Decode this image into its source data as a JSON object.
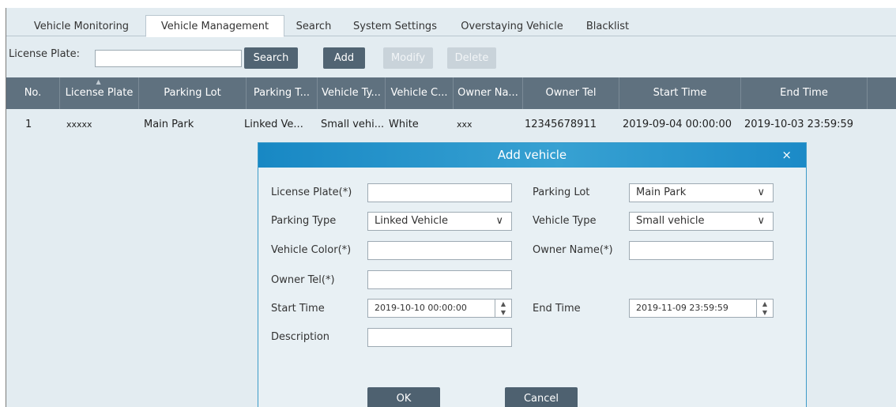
{
  "tabs": [
    {
      "label": "Vehicle Monitoring",
      "active": false
    },
    {
      "label": "Vehicle Management",
      "active": true
    },
    {
      "label": "Search",
      "active": false
    },
    {
      "label": "System Settings",
      "active": false
    },
    {
      "label": "Overstaying Vehicle",
      "active": false
    },
    {
      "label": "Blacklist",
      "active": false
    }
  ],
  "toolbar": {
    "license_plate_label": "License Plate:",
    "license_plate_value": "",
    "search_label": "Search",
    "add_label": "Add",
    "modify_label": "Modify",
    "delete_label": "Delete"
  },
  "table": {
    "columns": [
      "No.",
      "License Plate",
      "Parking Lot",
      "Parking T...",
      "Vehicle Ty...",
      "Vehicle C...",
      "Owner Na...",
      "Owner Tel",
      "Start Time",
      "End Time"
    ],
    "rows": [
      [
        "1",
        "xxxxx",
        "Main Park",
        "Linked Ve...",
        "Small vehi...",
        "White",
        "xxx",
        "12345678911",
        "2019-09-04 00:00:00",
        "2019-10-03 23:59:59"
      ]
    ]
  },
  "dialog": {
    "title": "Add vehicle",
    "close_glyph": "×",
    "license_plate_label": "License Plate(*)",
    "license_plate_value": "",
    "parking_lot_label": "Parking Lot",
    "parking_lot_value": "Main Park",
    "parking_type_label": "Parking Type",
    "parking_type_value": "Linked Vehicle",
    "vehicle_type_label": "Vehicle Type",
    "vehicle_type_value": "Small vehicle",
    "vehicle_color_label": "Vehicle Color(*)",
    "vehicle_color_value": "",
    "owner_name_label": "Owner Name(*)",
    "owner_name_value": "",
    "owner_tel_label": "Owner Tel(*)",
    "owner_tel_value": "",
    "start_time_label": "Start Time",
    "start_time_value": "2019-10-10 00:00:00",
    "end_time_label": "End Time",
    "end_time_value": "2019-11-09 23:59:59",
    "description_label": "Description",
    "description_value": "",
    "ok_label": "OK",
    "cancel_label": "Cancel"
  },
  "colors": {
    "accent": "#2a95cc",
    "header": "#5f717f",
    "button": "#516473"
  }
}
